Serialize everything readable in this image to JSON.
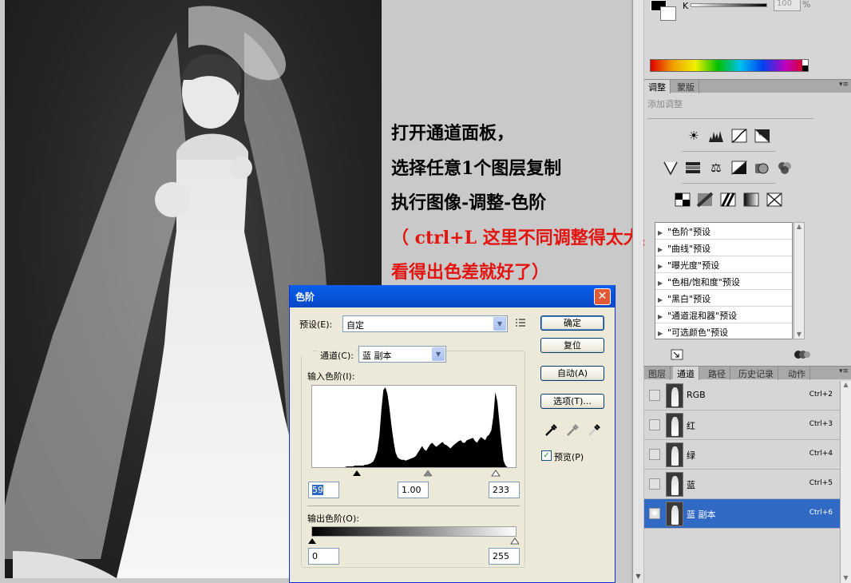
{
  "instructions": {
    "line1": "打开通道面板，",
    "line2": "选择任意1个图层复制",
    "line3": "执行图像-调整-色阶",
    "line4": "（ ctrl+L  这里不同调整得太大，",
    "line5": "看得出色差就好了）"
  },
  "levels_dialog": {
    "title": "色阶",
    "close_glyph": "✕",
    "preset_label": "预设(E):",
    "preset_value": "自定",
    "preset_menu_icon": "list-menu-icon",
    "channel_label": "通道(C):",
    "channel_value": "蓝 副本",
    "input_levels_label": "输入色阶(I):",
    "input_black": "59",
    "input_gamma": "1.00",
    "input_white": "233",
    "output_levels_label": "输出色阶(O):",
    "output_black": "0",
    "output_white": "255",
    "buttons": {
      "ok": "确定",
      "reset": "复位",
      "auto": "自动(A)",
      "options": "选项(T)..."
    },
    "preview_label": "预览(P)",
    "preview_checked": true,
    "histogram": [
      0,
      0,
      0,
      0,
      0,
      0,
      0,
      0,
      0,
      0,
      0,
      0,
      0,
      0,
      0,
      0,
      0,
      1,
      1,
      1,
      1,
      2,
      2,
      2,
      2,
      2,
      3,
      3,
      4,
      5,
      7,
      12,
      20,
      38,
      70,
      95,
      98,
      90,
      72,
      50,
      32,
      18,
      12,
      10,
      9,
      9,
      8,
      9,
      10,
      11,
      12,
      14,
      18,
      22,
      26,
      22,
      20,
      24,
      28,
      30,
      27,
      25,
      27,
      29,
      31,
      28,
      27,
      25,
      23,
      26,
      28,
      30,
      32,
      33,
      30,
      30,
      33,
      34,
      35,
      36,
      32,
      30,
      34,
      37,
      35,
      33,
      38,
      40,
      45,
      62,
      92,
      80,
      55,
      30,
      8,
      2,
      0,
      0,
      0,
      0,
      0
    ]
  },
  "colors_strip": {
    "k_label": "K",
    "k_value": "100",
    "percent": "%"
  },
  "adjustments_panel": {
    "tabs": [
      "调整",
      "蒙版"
    ],
    "add_label": "添加调整",
    "presets": [
      "\"色阶\"预设",
      "\"曲线\"预设",
      "\"曝光度\"预设",
      "\"色相/饱和度\"预设",
      "\"黑白\"预设",
      "\"通道混和器\"预设",
      "\"可选颜色\"预设"
    ]
  },
  "channels_panel": {
    "tabs": [
      "图层",
      "通道",
      "路径",
      "历史记录",
      "动作"
    ],
    "rows": [
      {
        "name": "RGB",
        "shortcut": "Ctrl+2"
      },
      {
        "name": "红",
        "shortcut": "Ctrl+3"
      },
      {
        "name": "绿",
        "shortcut": "Ctrl+4"
      },
      {
        "name": "蓝",
        "shortcut": "Ctrl+5"
      },
      {
        "name": "蓝 副本",
        "shortcut": "Ctrl+6"
      }
    ]
  }
}
